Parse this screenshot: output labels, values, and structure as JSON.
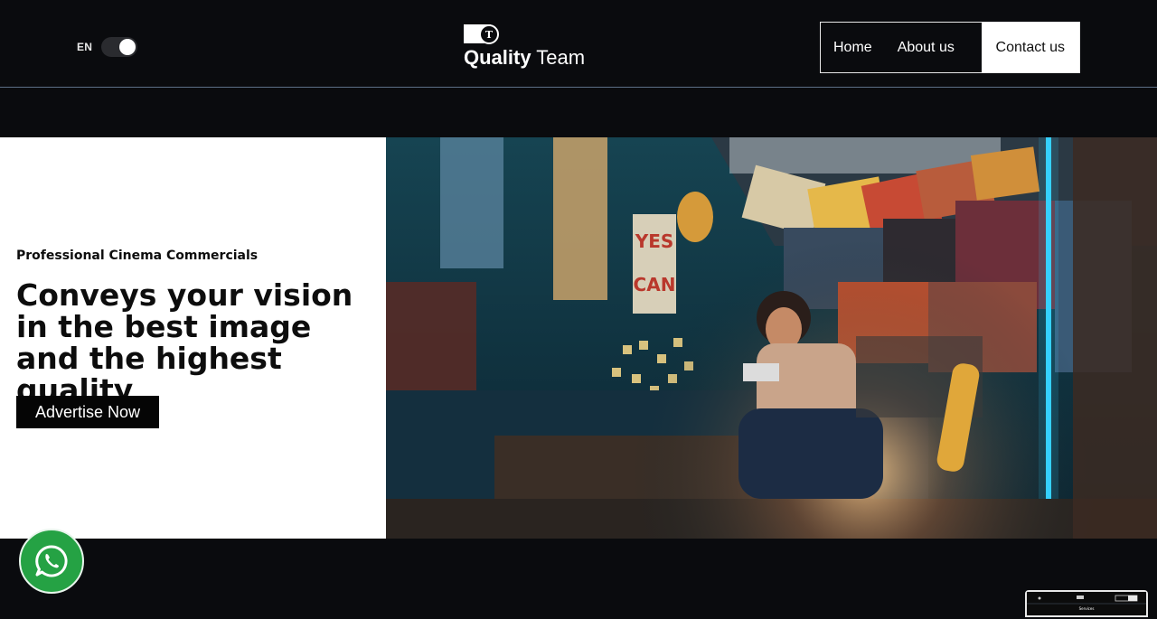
{
  "header": {
    "lang_label": "EN",
    "logo": {
      "bold": "Quality",
      "light": "Team"
    },
    "nav": [
      {
        "label": "Home"
      },
      {
        "label": "About us"
      },
      {
        "label": "Contact us"
      }
    ],
    "active_nav": "Contact us"
  },
  "hero": {
    "eyebrow": "Professional Cinema Commercials",
    "headline": "Conveys your vision in the best image and the highest quality",
    "cta_label": "Advertise Now",
    "image_alt": "person-in-bedroom-with-movie-posters"
  },
  "floating": {
    "whatsapp_icon": "whatsapp-icon"
  },
  "thumbnail": {
    "label": "Services"
  },
  "colors": {
    "background": "#0a0b0e",
    "accent_white": "#ffffff",
    "whatsapp_green": "#25a244",
    "header_border": "#5c6f86"
  }
}
